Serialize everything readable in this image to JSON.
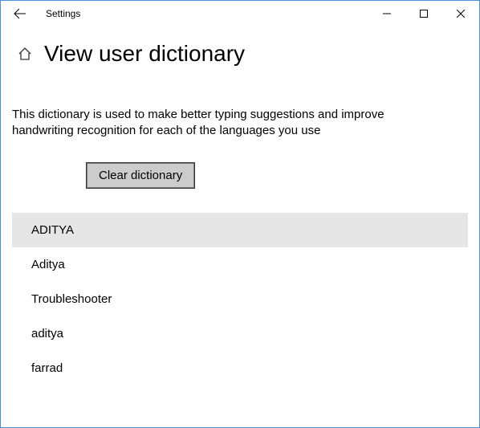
{
  "titlebar": {
    "title": "Settings"
  },
  "header": {
    "page_title": "View user dictionary"
  },
  "content": {
    "description": "This dictionary is used to make better typing suggestions and improve handwriting recognition for each of the languages you use",
    "clear_button": "Clear dictionary"
  },
  "dictionary": {
    "items": [
      "ADITYA",
      "Aditya",
      "Troubleshooter",
      "aditya",
      "farrad"
    ],
    "selected_index": 0
  }
}
